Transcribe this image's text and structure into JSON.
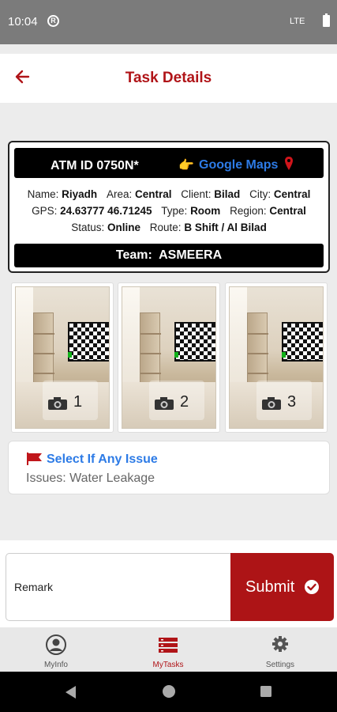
{
  "status_bar": {
    "time": "10:04",
    "network": "LTE"
  },
  "app_bar": {
    "title": "Task Details",
    "back_icon": "arrow-left-icon"
  },
  "atm": {
    "id_label": "ATM ID 0750N*",
    "maps_label": "Google Maps",
    "name_key": "Name:",
    "name_value": "Riyadh",
    "area_key": "Area:",
    "area_value": "Central",
    "client_key": "Client:",
    "client_value": "Bilad",
    "city_key": "City:",
    "city_value": "Central",
    "gps_key": "GPS:",
    "gps_value": "24.63777 46.71245",
    "type_key": "Type:",
    "type_value": "Room",
    "region_key": "Region:",
    "region_value": "Central",
    "status_key": "Status:",
    "status_value": "Online",
    "route_key": "Route:",
    "route_value": "B Shift / Al Bilad",
    "team_key": "Team:",
    "team_value": "ASMEERA"
  },
  "photos": [
    {
      "number": "1",
      "icon": "camera-icon"
    },
    {
      "number": "2",
      "icon": "camera-icon"
    },
    {
      "number": "3",
      "icon": "camera-icon"
    }
  ],
  "issue": {
    "select_label": "Select If Any Issue",
    "issues_text": "Issues: Water Leakage",
    "flag_icon": "flag-icon"
  },
  "remark": {
    "placeholder": "Remark",
    "value": ""
  },
  "submit": {
    "label": "Submit"
  },
  "bottom_nav": {
    "items": [
      {
        "label": "MyInfo",
        "icon": "user-circle-icon"
      },
      {
        "label": "MyTasks",
        "icon": "tasks-icon",
        "active": true
      },
      {
        "label": "Settings",
        "icon": "gear-icon"
      }
    ]
  },
  "colors": {
    "brand": "#b01418",
    "link": "#2d7be6"
  }
}
